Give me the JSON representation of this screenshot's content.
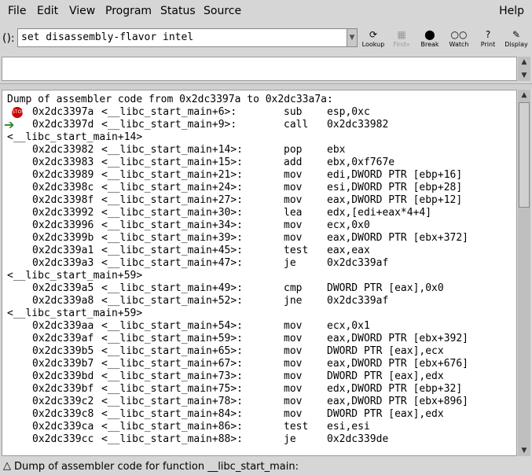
{
  "menu": [
    "File",
    "Edit",
    "View",
    "Program",
    "Status",
    "Source",
    "Help"
  ],
  "command": {
    "label": "():",
    "value": "set disassembly-flavor intel"
  },
  "toolbar": [
    {
      "icon": "lookup-icon",
      "label": "Lookup",
      "disabled": false
    },
    {
      "icon": "find-icon",
      "label": "Find»",
      "disabled": true
    },
    {
      "icon": "break-icon",
      "label": "Break",
      "disabled": false
    },
    {
      "icon": "watch-icon",
      "label": "Watch",
      "disabled": false
    },
    {
      "icon": "print-icon",
      "label": "Print",
      "disabled": false
    },
    {
      "icon": "display-icon",
      "label": "Display",
      "disabled": false
    }
  ],
  "dump_header": "Dump of assembler code from 0x2dc3397a to 0x2dc33a7a:",
  "code": [
    {
      "type": "insn",
      "marker": "stop",
      "addr": "0x2dc3397a",
      "sym": "<__libc_start_main+6>:",
      "mn": "sub",
      "op": "esp,0xc"
    },
    {
      "type": "insn",
      "marker": "arrow",
      "addr": "0x2dc3397d",
      "sym": "<__libc_start_main+9>:",
      "mn": "call",
      "op": "0x2dc33982"
    },
    {
      "type": "label",
      "text": "<__libc_start_main+14>"
    },
    {
      "type": "insn",
      "addr": "0x2dc33982",
      "sym": "<__libc_start_main+14>:",
      "mn": "pop",
      "op": "ebx"
    },
    {
      "type": "insn",
      "addr": "0x2dc33983",
      "sym": "<__libc_start_main+15>:",
      "mn": "add",
      "op": "ebx,0xf767e"
    },
    {
      "type": "insn",
      "addr": "0x2dc33989",
      "sym": "<__libc_start_main+21>:",
      "mn": "mov",
      "op": "edi,DWORD PTR [ebp+16]"
    },
    {
      "type": "insn",
      "addr": "0x2dc3398c",
      "sym": "<__libc_start_main+24>:",
      "mn": "mov",
      "op": "esi,DWORD PTR [ebp+28]"
    },
    {
      "type": "insn",
      "addr": "0x2dc3398f",
      "sym": "<__libc_start_main+27>:",
      "mn": "mov",
      "op": "eax,DWORD PTR [ebp+12]"
    },
    {
      "type": "insn",
      "addr": "0x2dc33992",
      "sym": "<__libc_start_main+30>:",
      "mn": "lea",
      "op": "edx,[edi+eax*4+4]"
    },
    {
      "type": "insn",
      "addr": "0x2dc33996",
      "sym": "<__libc_start_main+34>:",
      "mn": "mov",
      "op": "ecx,0x0"
    },
    {
      "type": "insn",
      "addr": "0x2dc3399b",
      "sym": "<__libc_start_main+39>:",
      "mn": "mov",
      "op": "eax,DWORD PTR [ebx+372]"
    },
    {
      "type": "insn",
      "addr": "0x2dc339a1",
      "sym": "<__libc_start_main+45>:",
      "mn": "test",
      "op": "eax,eax"
    },
    {
      "type": "insn",
      "addr": "0x2dc339a3",
      "sym": "<__libc_start_main+47>:",
      "mn": "je",
      "op": "0x2dc339af"
    },
    {
      "type": "label",
      "text": "<__libc_start_main+59>"
    },
    {
      "type": "insn",
      "addr": "0x2dc339a5",
      "sym": "<__libc_start_main+49>:",
      "mn": "cmp",
      "op": "DWORD PTR [eax],0x0"
    },
    {
      "type": "insn",
      "addr": "0x2dc339a8",
      "sym": "<__libc_start_main+52>:",
      "mn": "jne",
      "op": "0x2dc339af"
    },
    {
      "type": "label",
      "text": "<__libc_start_main+59>"
    },
    {
      "type": "insn",
      "addr": "0x2dc339aa",
      "sym": "<__libc_start_main+54>:",
      "mn": "mov",
      "op": "ecx,0x1"
    },
    {
      "type": "insn",
      "addr": "0x2dc339af",
      "sym": "<__libc_start_main+59>:",
      "mn": "mov",
      "op": "eax,DWORD PTR [ebx+392]"
    },
    {
      "type": "insn",
      "addr": "0x2dc339b5",
      "sym": "<__libc_start_main+65>:",
      "mn": "mov",
      "op": "DWORD PTR [eax],ecx"
    },
    {
      "type": "insn",
      "addr": "0x2dc339b7",
      "sym": "<__libc_start_main+67>:",
      "mn": "mov",
      "op": "eax,DWORD PTR [ebx+676]"
    },
    {
      "type": "insn",
      "addr": "0x2dc339bd",
      "sym": "<__libc_start_main+73>:",
      "mn": "mov",
      "op": "DWORD PTR [eax],edx"
    },
    {
      "type": "insn",
      "addr": "0x2dc339bf",
      "sym": "<__libc_start_main+75>:",
      "mn": "mov",
      "op": "edx,DWORD PTR [ebp+32]"
    },
    {
      "type": "insn",
      "addr": "0x2dc339c2",
      "sym": "<__libc_start_main+78>:",
      "mn": "mov",
      "op": "eax,DWORD PTR [ebx+896]"
    },
    {
      "type": "insn",
      "addr": "0x2dc339c8",
      "sym": "<__libc_start_main+84>:",
      "mn": "mov",
      "op": "DWORD PTR [eax],edx"
    },
    {
      "type": "insn",
      "addr": "0x2dc339ca",
      "sym": "<__libc_start_main+86>:",
      "mn": "test",
      "op": "esi,esi"
    },
    {
      "type": "insn",
      "addr": "0x2dc339cc",
      "sym": "<__libc_start_main+88>:",
      "mn": "je",
      "op": "0x2dc339de"
    }
  ],
  "status": "Dump of assembler code for function __libc_start_main:"
}
